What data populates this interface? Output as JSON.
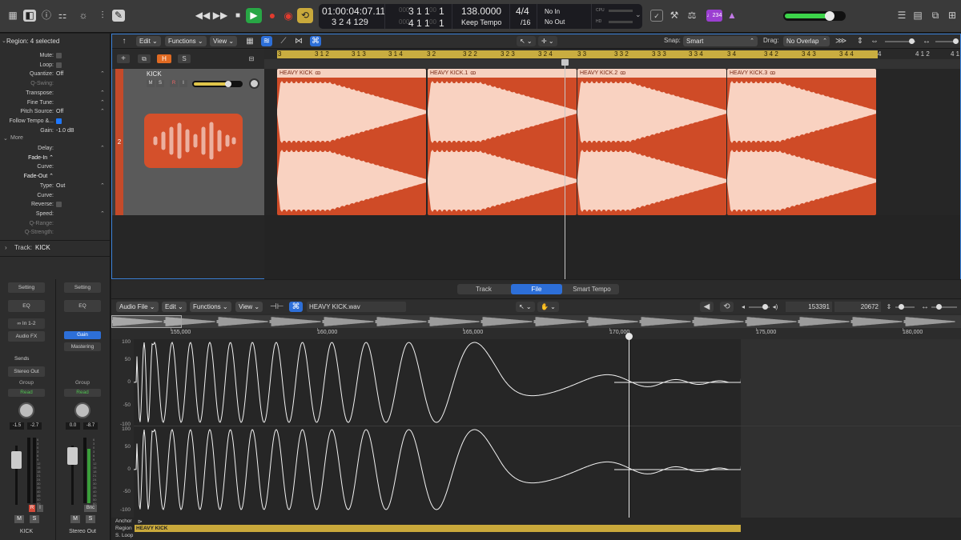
{
  "control_bar": {
    "lcd": {
      "time": "01:00:04:07.11",
      "time_sub": "3 2 4 129",
      "bar_top": "3 1 1",
      "bar_top_last": "1",
      "bar_bottom": "4 1 1",
      "bar_bottom_last": "1",
      "dim_top": "000",
      "dim_bottom": "000",
      "tempo": "138.0000",
      "tempo_mode": "Keep Tempo",
      "sig_top": "4/4",
      "sig_bottom": "/16",
      "in": "No In",
      "out": "No Out",
      "cpu": "CPU",
      "hd": "HD"
    },
    "badge": "♩234"
  },
  "inspector": {
    "region_header": "Region: 4 selected",
    "rows": [
      {
        "label": "Mute:",
        "type": "check"
      },
      {
        "label": "Loop:",
        "type": "check"
      },
      {
        "label": "Quantize:",
        "value": "Off",
        "updown": true
      },
      {
        "label": "Q-Swing:",
        "dim": true
      },
      {
        "label": "Transpose:",
        "updown": true
      },
      {
        "label": "Fine Tune:",
        "updown": true
      },
      {
        "label": "Pitch Source:",
        "value": "Off",
        "updown": true
      },
      {
        "label": "Follow Tempo &...",
        "type": "check_on"
      },
      {
        "label": "Gain:",
        "value": "-1.0 dB"
      }
    ],
    "more_label": "More",
    "more_rows": [
      {
        "label": "Delay:",
        "updown": true
      },
      {
        "label": "Fade-In ⌃",
        "bright": true
      },
      {
        "label": "Curve:"
      },
      {
        "label": "Fade-Out ⌃",
        "bright": true
      },
      {
        "label": "Type:",
        "value": "Out",
        "updown": true
      },
      {
        "label": "Curve:"
      },
      {
        "label": "Reverse:",
        "type": "check"
      },
      {
        "label": "Speed:",
        "updown": true
      },
      {
        "label": "Q-Range:",
        "dim": true
      },
      {
        "label": "Q-Strength:",
        "dim": true
      }
    ],
    "track_header": "Track:",
    "track_name": "KICK",
    "strip1": {
      "setting": "Setting",
      "eq": "EQ",
      "input": "In 1-2",
      "audiofx": "Audio FX",
      "sends": "Sends",
      "output": "Stereo Out",
      "group": "Group",
      "auto": "Read",
      "vol1": "-1.5",
      "vol2": "-2.7",
      "m": "M",
      "s": "S",
      "r": "R",
      "i": "I",
      "name": "KICK"
    },
    "strip2": {
      "setting": "Setting",
      "eq": "EQ",
      "gain": "Gain",
      "mastering": "Mastering",
      "group": "Group",
      "auto": "Read",
      "vol1": "0.0",
      "vol2": "-8.7",
      "bnc": "Bnc",
      "m": "M",
      "s": "S",
      "name": "Stereo Out"
    },
    "meter_scale": [
      "6",
      "3",
      "0",
      "3",
      "6",
      "9",
      "12",
      "15",
      "18",
      "21",
      "24",
      "30",
      "35",
      "40",
      "45",
      "50",
      "60"
    ]
  },
  "tracks": {
    "menus": {
      "edit": "Edit",
      "functions": "Functions",
      "view": "View"
    },
    "snap_label": "Snap:",
    "snap_value": "Smart",
    "drag_label": "Drag:",
    "drag_value": "No Overlap",
    "header_buttons": {
      "h": "H",
      "s": "S"
    },
    "track": {
      "number": "2",
      "name": "KICK",
      "m": "M",
      "s": "S",
      "r": "R",
      "i": "I"
    },
    "ruler": [
      "3",
      "3 1 2",
      "3 1 3",
      "3 1 4",
      "3 2",
      "3 2 2",
      "3 2 3",
      "3 2 4",
      "3 3",
      "3 3 2",
      "3 3 3",
      "3 3 4",
      "3 4",
      "3 4 2",
      "3 4 3",
      "3 4 4",
      "4",
      "4 1 2",
      "4 1"
    ],
    "regions": [
      "HEAVY KICK",
      "HEAVY KICK.1",
      "HEAVY KICK.2",
      "HEAVY KICK.3"
    ],
    "loop_glyph": "ꝏ"
  },
  "editor": {
    "tabs": [
      "Track",
      "File",
      "Smart Tempo"
    ],
    "active_tab": "File",
    "menus": {
      "audio_file": "Audio File",
      "edit": "Edit",
      "functions": "Functions",
      "view": "View"
    },
    "filename": "HEAVY KICK.wav",
    "sample_pos1": "153391",
    "sample_pos2": "20672",
    "ruler": [
      "155,000",
      "160,000",
      "165,000",
      "170,000",
      "175,000",
      "180,000"
    ],
    "y_labels": [
      "100",
      "50",
      "0",
      "-50",
      "-100"
    ],
    "lanes": {
      "anchor": "Anchor",
      "region": "Region",
      "loop": "S. Loop"
    },
    "region_name": "HEAVY KICK"
  },
  "colors": {
    "accent_blue": "#1f78ff",
    "region": "#cf4b27",
    "region_header": "#f6d2c1",
    "waveform": "#f9d2c1",
    "yellow": "#c9a93b",
    "green": "#28a745",
    "red": "#e23b2e"
  }
}
